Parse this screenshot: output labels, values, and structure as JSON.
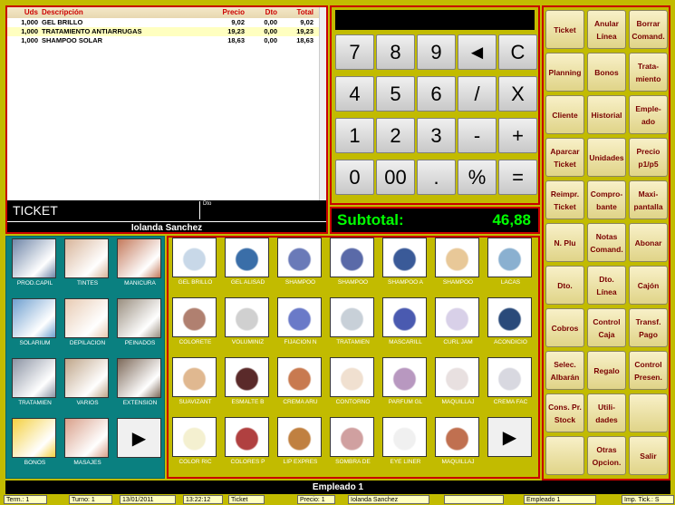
{
  "ticket": {
    "columns": {
      "uds": "Uds",
      "desc": "Descripción",
      "precio": "Precio",
      "dto": "Dto",
      "total": "Total"
    },
    "lines": [
      {
        "uds": "1,000",
        "desc": "GEL BRILLO",
        "precio": "9,02",
        "dto": "0,00",
        "total": "9,02"
      },
      {
        "uds": "1,000",
        "desc": "TRATAMIENTO ANTIARRUGAS",
        "precio": "19,23",
        "dto": "0,00",
        "total": "19,23"
      },
      {
        "uds": "1,000",
        "desc": "SHAMPOO SOLAR",
        "precio": "18,63",
        "dto": "0,00",
        "total": "18,63"
      }
    ],
    "label": "TICKET",
    "dto_label": "Dto",
    "client_name": "Iolanda Sanchez"
  },
  "keypad": {
    "keys": [
      "7",
      "8",
      "9",
      "◄",
      "C",
      "4",
      "5",
      "6",
      "/",
      "X",
      "1",
      "2",
      "3",
      "-",
      "+",
      "0",
      "00",
      ".",
      "%",
      "="
    ],
    "subtotal_label": "Subtotal:",
    "subtotal_value": "46,88"
  },
  "functions": [
    "Ticket",
    "Anular Línea",
    "Borrar Comand.",
    "Planning",
    "Bonos",
    "Trata- miento",
    "Cliente",
    "Historial",
    "Emple- ado",
    "Aparcar Ticket",
    "Unidades",
    "Precio p1/p5",
    "Reimpr. Ticket",
    "Compro- bante",
    "Maxi- pantalla",
    "N. Plu",
    "Notas Comand.",
    "Abonar",
    "Dto.",
    "Dto. Línea",
    "Cajón",
    "Cobros",
    "Control Caja",
    "Transf. Pago",
    "Selec. Albarán",
    "Regalo",
    "Control Presen.",
    "Cons. Pr. Stock",
    "Utili- dades",
    "",
    "",
    "Otras Opcion.",
    "Salir"
  ],
  "categories": [
    "PROD.CAPIL",
    "TINTES",
    "MANICURA",
    "SOLARIUM",
    "DEPILACIÓN",
    "PEINADOS",
    "TRATAMIEN",
    "VARIOS",
    "EXTENSION",
    "BONOS",
    "MASAJES",
    ""
  ],
  "products": [
    "GEL BRILLO",
    "GEL ALISAD",
    "SHAMPOO",
    "SHAMPOO",
    "SHAMPOO A",
    "SHAMPOO",
    "LACAS",
    "COLORETE",
    "VOLUMINIZ",
    "FIJACIÓN N",
    "TRATAMIEN",
    "MASCARILL",
    "CURL JAM",
    "ACONDICIO",
    "SUAVIZANT",
    "ESMALTE B",
    "CREMA ARU",
    "CONTORNO",
    "PARFUM GL",
    "MAQUILLAJ",
    "CREMA FAC",
    "COLOR RIC",
    "COLORES P",
    "LIP EXPRES",
    "SOMBRA DE",
    "EYE LINER",
    "MAQUILLAJ",
    ""
  ],
  "footer": {
    "employee": "Empleado 1",
    "status": [
      "Term.: 1",
      "Turno: 1",
      "13/01/2011",
      "13:22:12",
      "Ticket",
      "Precio: 1",
      "Iolanda Sanchez",
      "",
      "Empleado 1",
      "Imp. Tick.: S"
    ]
  },
  "colors": {
    "background": "#c2bb00",
    "border": "#c80000",
    "category_bg": "#0a8080",
    "subtotal": "#00ff00"
  }
}
